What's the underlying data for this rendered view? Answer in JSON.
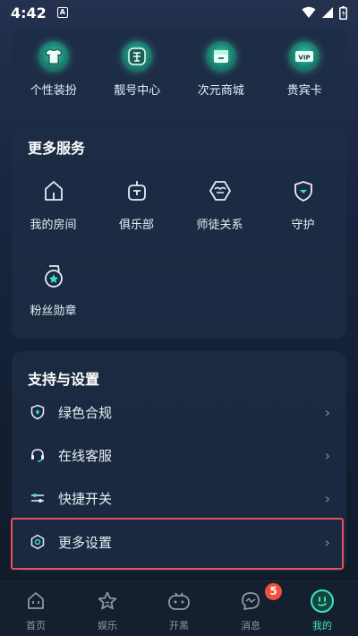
{
  "status_bar": {
    "time": "4:42",
    "notification_icon": "A"
  },
  "top_shortcuts": [
    {
      "label": "个性装扮",
      "icon": "tshirt-icon"
    },
    {
      "label": "靓号中心",
      "icon": "liang-badge-icon"
    },
    {
      "label": "次元商城",
      "icon": "shop-icon"
    },
    {
      "label": "贵宾卡",
      "icon": "vip-card-icon"
    }
  ],
  "services": {
    "title": "更多服务",
    "items": [
      {
        "label": "我的房间",
        "icon": "room-icon"
      },
      {
        "label": "俱乐部",
        "icon": "club-icon"
      },
      {
        "label": "师徒关系",
        "icon": "mentor-icon"
      },
      {
        "label": "守护",
        "icon": "shield-icon"
      },
      {
        "label": "粉丝勋章",
        "icon": "medal-icon"
      }
    ]
  },
  "settings": {
    "title": "支持与设置",
    "items": [
      {
        "label": "绿色合规",
        "icon": "compliance-shield-icon"
      },
      {
        "label": "在线客服",
        "icon": "headset-icon"
      },
      {
        "label": "快捷开关",
        "icon": "switch-icon"
      },
      {
        "label": "更多设置",
        "icon": "hexagon-settings-icon"
      }
    ],
    "arrow": "›"
  },
  "tabbar": {
    "tabs": [
      {
        "label": "首页",
        "icon": "home-icon"
      },
      {
        "label": "娱乐",
        "icon": "star-icon"
      },
      {
        "label": "开黑",
        "icon": "gamepad-icon"
      },
      {
        "label": "消息",
        "icon": "message-icon",
        "badge": "5"
      },
      {
        "label": "我的",
        "icon": "profile-icon"
      }
    ],
    "active_index": 4
  },
  "colors": {
    "accent": "#3fe0c0",
    "badge": "#f2503b",
    "highlight": "#e8505b"
  }
}
